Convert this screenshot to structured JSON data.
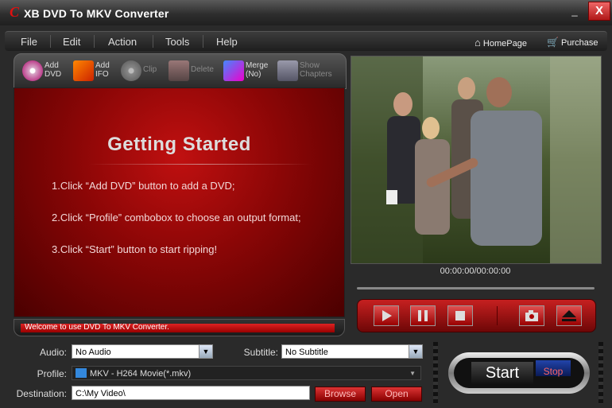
{
  "window": {
    "logo": "C",
    "title": "XB DVD To MKV Converter",
    "minimize": "_",
    "close": "X"
  },
  "menu": [
    "File",
    "Edit",
    "Action",
    "Tools",
    "Help"
  ],
  "links": {
    "homepage": "HomePage",
    "purchase": "Purchase"
  },
  "toolbar": [
    {
      "line1": "Add",
      "line2": "DVD",
      "enabled": true
    },
    {
      "line1": "Add",
      "line2": "IFO",
      "enabled": true
    },
    {
      "line1": "Clip",
      "line2": "",
      "enabled": false
    },
    {
      "line1": "Delete",
      "line2": "",
      "enabled": false
    },
    {
      "line1": "Merge",
      "line2": "(No)",
      "enabled": true
    },
    {
      "line1": "Show",
      "line2": "Chapters",
      "enabled": false
    }
  ],
  "getting_started": {
    "heading": "Getting  Started",
    "steps": [
      "1.Click “Add DVD” button to add a DVD;",
      "2.Click “Profile” combobox to choose an output format;",
      "3.Click “Start” button to start ripping!"
    ]
  },
  "status": "Welcome to use DVD To MKV Converter.",
  "player": {
    "time": "00:00:00/00:00:00"
  },
  "settings": {
    "audio_label": "Audio:",
    "audio_value": "No Audio",
    "subtitle_label": "Subtitle:",
    "subtitle_value": "No Subtitle",
    "profile_label": "Profile:",
    "profile_value": "MKV - H264 Movie(*.mkv)",
    "destination_label": "Destination:",
    "destination_value": "C:\\My Video\\",
    "browse": "Browse",
    "open": "Open"
  },
  "actions": {
    "start": "Start",
    "stop": "Stop"
  },
  "colors": {
    "accent_red": "#c01010",
    "panel_dark": "#2a2a2a"
  }
}
